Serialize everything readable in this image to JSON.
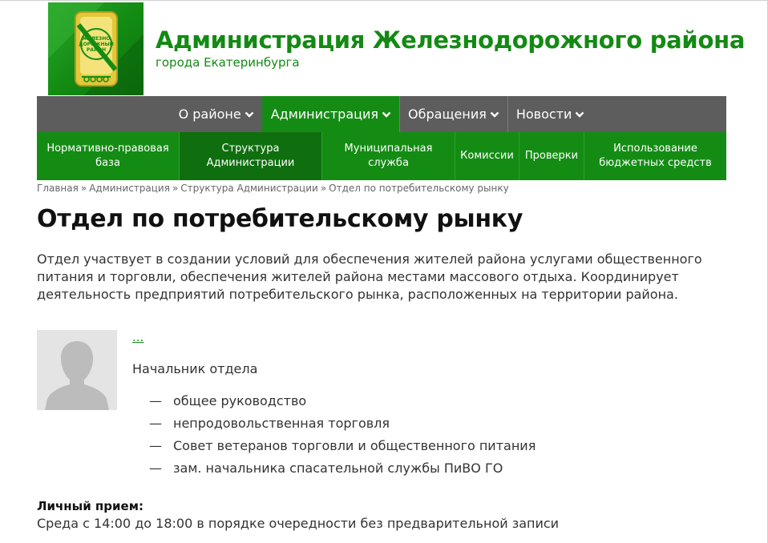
{
  "header": {
    "title": "Администрация Железнодорожного района",
    "subtitle": "города Екатеринбурга",
    "logo_text": [
      "ЖЕЛЕЗНО",
      "ДОРОЖНЫЙ",
      "РАЙОН"
    ]
  },
  "topnav": {
    "items": [
      {
        "label": "О районе",
        "icon": "chevron-down-icon"
      },
      {
        "label": "Администрация",
        "icon": "chevron-down-icon"
      },
      {
        "label": "Обращения",
        "icon": "chevron-down-icon"
      },
      {
        "label": "Новости",
        "icon": "chevron-down-icon"
      }
    ],
    "active_index": 1
  },
  "subnav": {
    "items": [
      {
        "line1": "Нормативно-правовая",
        "line2": "база"
      },
      {
        "line1": "Структура",
        "line2": "Администрации"
      },
      {
        "line1": "Муниципальная",
        "line2": "служба"
      },
      {
        "line1": "Комиссии",
        "line2": ""
      },
      {
        "line1": "Проверки",
        "line2": ""
      },
      {
        "line1": "Использование",
        "line2": "бюджетных средств"
      }
    ],
    "active_index": 1
  },
  "breadcrumb": {
    "items": [
      "Главная",
      "Администрация",
      "Структура Администрации",
      "Отдел по потребительскому рынку"
    ],
    "separator": "»"
  },
  "page": {
    "title": "Отдел по потребительскому рынку",
    "intro": "Отдел участвует в создании условий для обеспечения жителей района услугами общественного питания и торговли, обеспечения жителей района местами массового отдыха. Координирует деятельность предприятий потребительского рынка, расположенных на территории района."
  },
  "person": {
    "name": "...",
    "role": "Начальник отдела",
    "duty_marker": "—",
    "duties": [
      "общее руководство",
      "непродовольственная торговля",
      "Совет ветеранов торговли и общественного питания",
      "зам. начальника спасательной службы ПиВО ГО"
    ]
  },
  "reception": {
    "label": "Личный прием:",
    "text": "Среда с 14:00 до 18:00 в порядке очередности без предварительной записи"
  },
  "colors": {
    "brand_green": "#148c14",
    "nav_gray": "#5d5d5d",
    "subnav_active": "#0f6f0f"
  }
}
